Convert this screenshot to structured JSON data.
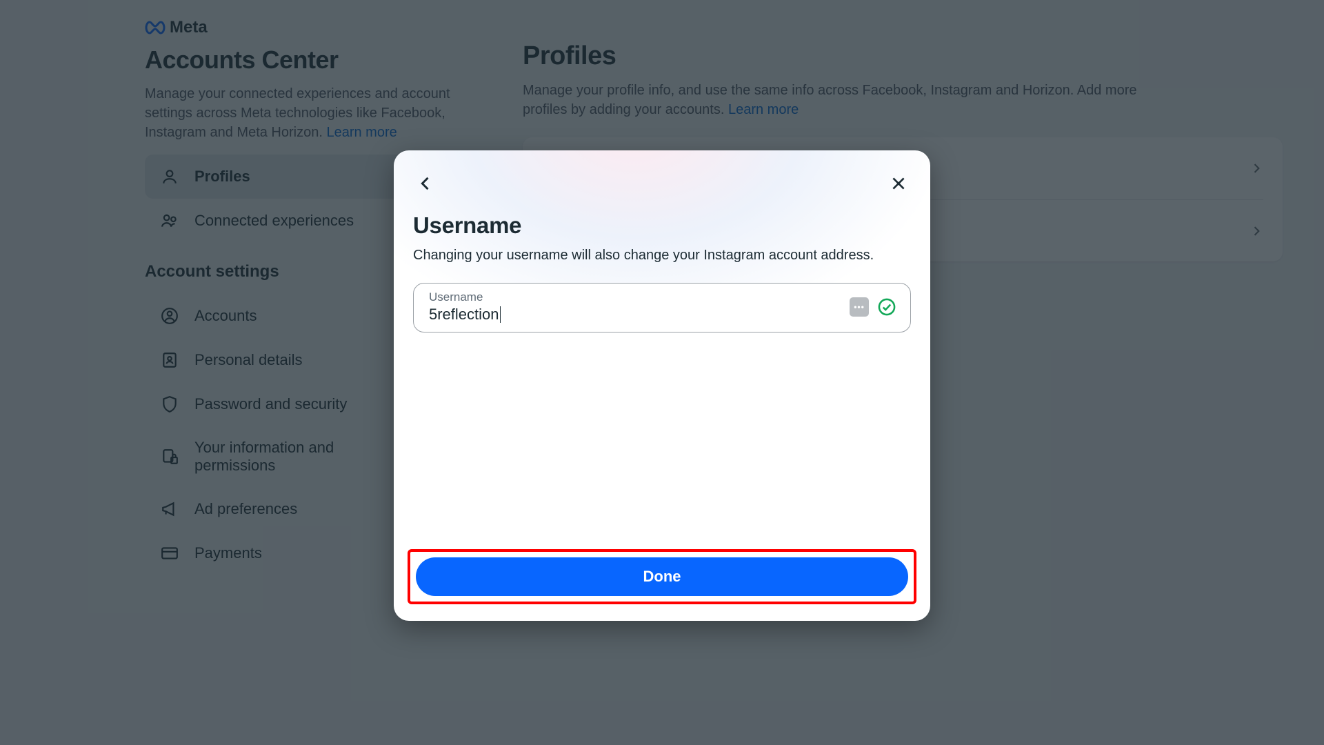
{
  "brand": {
    "name": "Meta"
  },
  "sidebar": {
    "title": "Accounts Center",
    "description": "Manage your connected experiences and account settings across Meta technologies like Facebook, Instagram and Meta Horizon.",
    "learn_more": "Learn more",
    "section_label": "Account settings",
    "nav_main": [
      {
        "label": "Profiles",
        "icon": "person",
        "active": true
      },
      {
        "label": "Connected experiences",
        "icon": "people",
        "active": false
      }
    ],
    "nav_settings": [
      {
        "label": "Accounts",
        "icon": "account-circle"
      },
      {
        "label": "Personal details",
        "icon": "id-card"
      },
      {
        "label": "Password and security",
        "icon": "shield"
      },
      {
        "label": "Your information and permissions",
        "icon": "file-lock"
      },
      {
        "label": "Ad preferences",
        "icon": "megaphone"
      },
      {
        "label": "Payments",
        "icon": "credit-card"
      }
    ]
  },
  "main": {
    "title": "Profiles",
    "description": "Manage your profile info, and use the same info across Facebook, Instagram and Horizon. Add more profiles by adding your accounts.",
    "learn_more": "Learn more"
  },
  "modal": {
    "title": "Username",
    "subtitle": "Changing your username will also change your Instagram account address.",
    "field_label": "Username",
    "field_value": "5reflection",
    "done_label": "Done"
  }
}
